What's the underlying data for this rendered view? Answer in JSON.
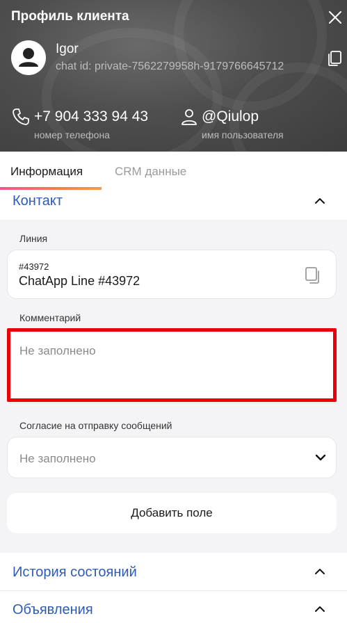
{
  "header": {
    "title": "Профиль клиента",
    "user_name": "Igor",
    "chat_id": "chat id: private-7562279958h-9179766645712",
    "phone": "+7 904 333 94 43",
    "phone_label": "номер телефона",
    "username": "@Qiulop",
    "username_label": "имя пользователя"
  },
  "tabs": [
    {
      "label": "Информация",
      "active": true
    },
    {
      "label": "CRM данные",
      "active": false
    }
  ],
  "contact": {
    "section_title": "Контакт",
    "line_label": "Линия",
    "line_id": "#43972",
    "line_name": "ChatApp Line #43972",
    "comment_label": "Комментарий",
    "comment_placeholder": "Не заполнено",
    "consent_label": "Согласие на отправку сообщений",
    "consent_value": "Не заполнено",
    "add_field_label": "Добавить поле"
  },
  "sections": [
    {
      "title": "История состояний"
    },
    {
      "title": "Объявления"
    }
  ],
  "colors": {
    "accent_blue": "#2d5bb5",
    "highlight_red": "#e8000b",
    "tab_gradient": [
      "#ff4f8b",
      "#ff9a3c"
    ]
  }
}
